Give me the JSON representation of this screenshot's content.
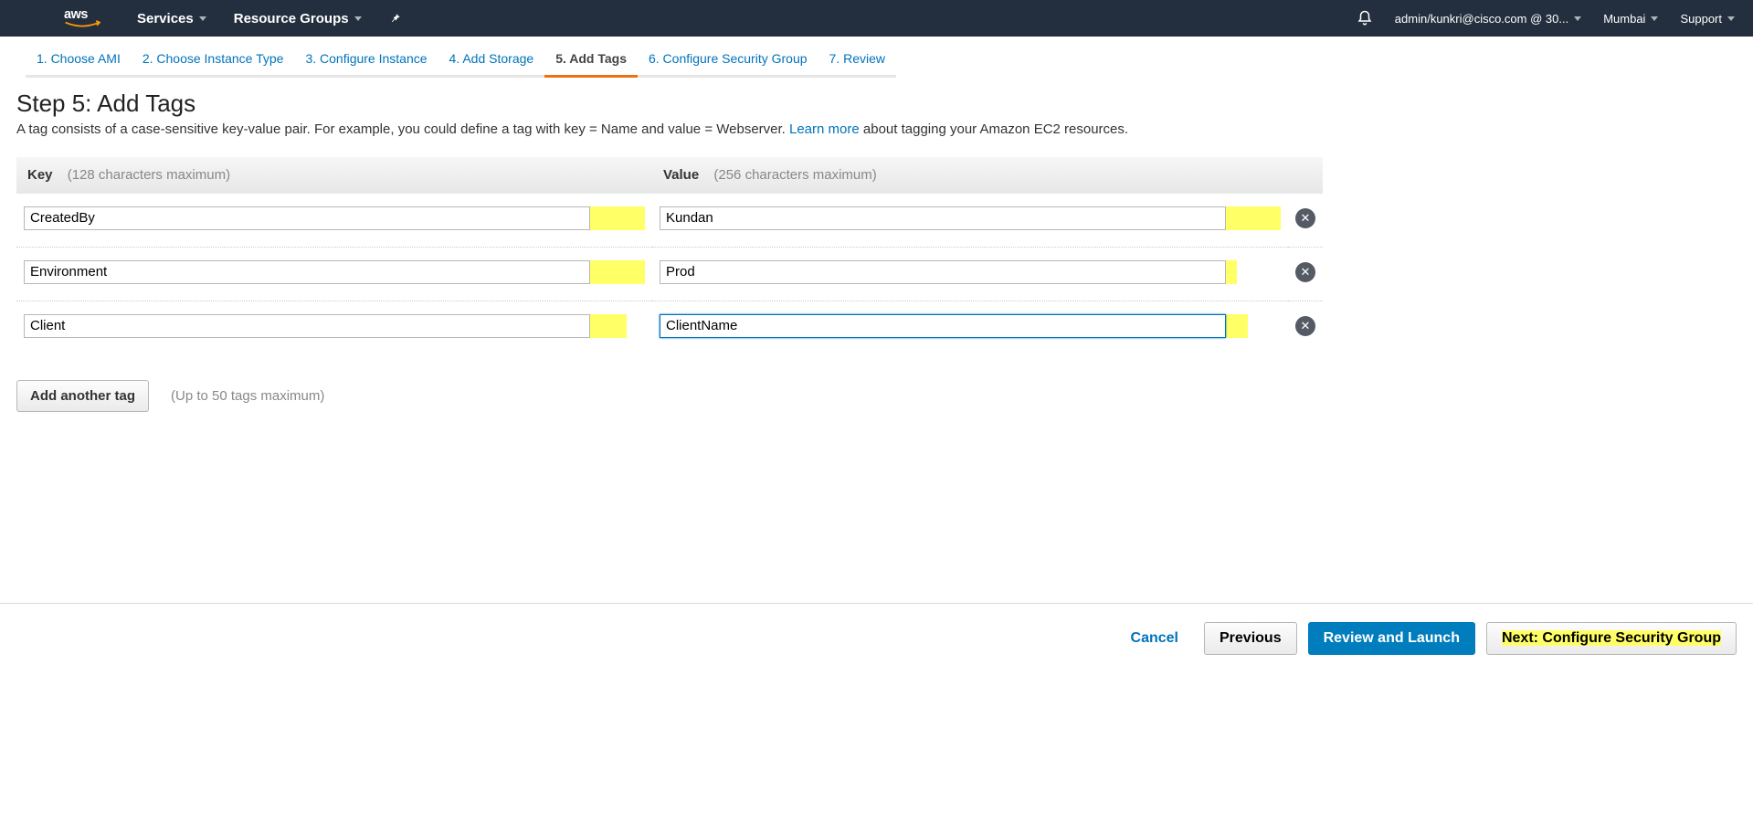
{
  "topnav": {
    "services": "Services",
    "resource_groups": "Resource Groups",
    "account": "admin/kunkri@cisco.com @ 30...",
    "region": "Mumbai",
    "support": "Support"
  },
  "wizard": {
    "steps": [
      "1. Choose AMI",
      "2. Choose Instance Type",
      "3. Configure Instance",
      "4. Add Storage",
      "5. Add Tags",
      "6. Configure Security Group",
      "7. Review"
    ],
    "active_index": 4
  },
  "header": {
    "title": "Step 5: Add Tags",
    "desc_pre": "A tag consists of a case-sensitive key-value pair. For example, you could define a tag with key = Name and value = Webserver. ",
    "learn_more": "Learn more",
    "desc_post": " about tagging your Amazon EC2 resources."
  },
  "table": {
    "key_header": "Key",
    "key_hint": "(128 characters maximum)",
    "value_header": "Value",
    "value_hint": "(256 characters maximum)",
    "rows": [
      {
        "key": "CreatedBy",
        "value": "Kundan"
      },
      {
        "key": "Environment",
        "value": "Prod"
      },
      {
        "key": "Client",
        "value": "ClientName"
      }
    ]
  },
  "addtag": {
    "label": "Add another tag",
    "hint": "(Up to 50 tags maximum)"
  },
  "footer": {
    "cancel": "Cancel",
    "previous": "Previous",
    "review_launch": "Review and Launch",
    "next": "Next: Configure Security Group"
  }
}
